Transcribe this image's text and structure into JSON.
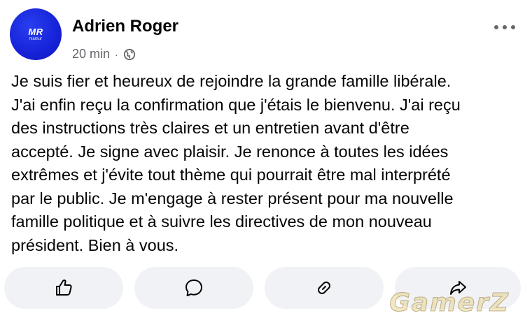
{
  "post": {
    "author": {
      "name": "Adrien Roger",
      "avatar_initials": "MR",
      "avatar_subtext": "Namur"
    },
    "timestamp": "20 min",
    "separator": "·",
    "visibility_icon": "globe-icon",
    "more_icon": "more-options-icon",
    "text": "Je suis fier et heureux de rejoindre la grande famille libérale.\nJ'ai enfin reçu la confirmation que j'étais le bienvenu. J'ai reçu\ndes instructions très claires et un entretien avant d'être\naccepté. Je signe avec plaisir. Je renonce à toutes les idées\nextrêmes et j'évite tout thème qui pourrait être mal interprété\npar le public. Je m'engage à rester présent pour ma nouvelle\nfamille politique et à suivre les directives de mon nouveau\nprésident. Bien à vous."
  },
  "actions": [
    {
      "icon": "like-icon"
    },
    {
      "icon": "comment-icon"
    },
    {
      "icon": "link-icon"
    },
    {
      "icon": "share-icon"
    }
  ],
  "watermark": "GamerZ",
  "colors": {
    "avatar": "#1622d8",
    "text": "#050505",
    "secondary": "#65676b",
    "action_bg": "#f0f2f5"
  }
}
